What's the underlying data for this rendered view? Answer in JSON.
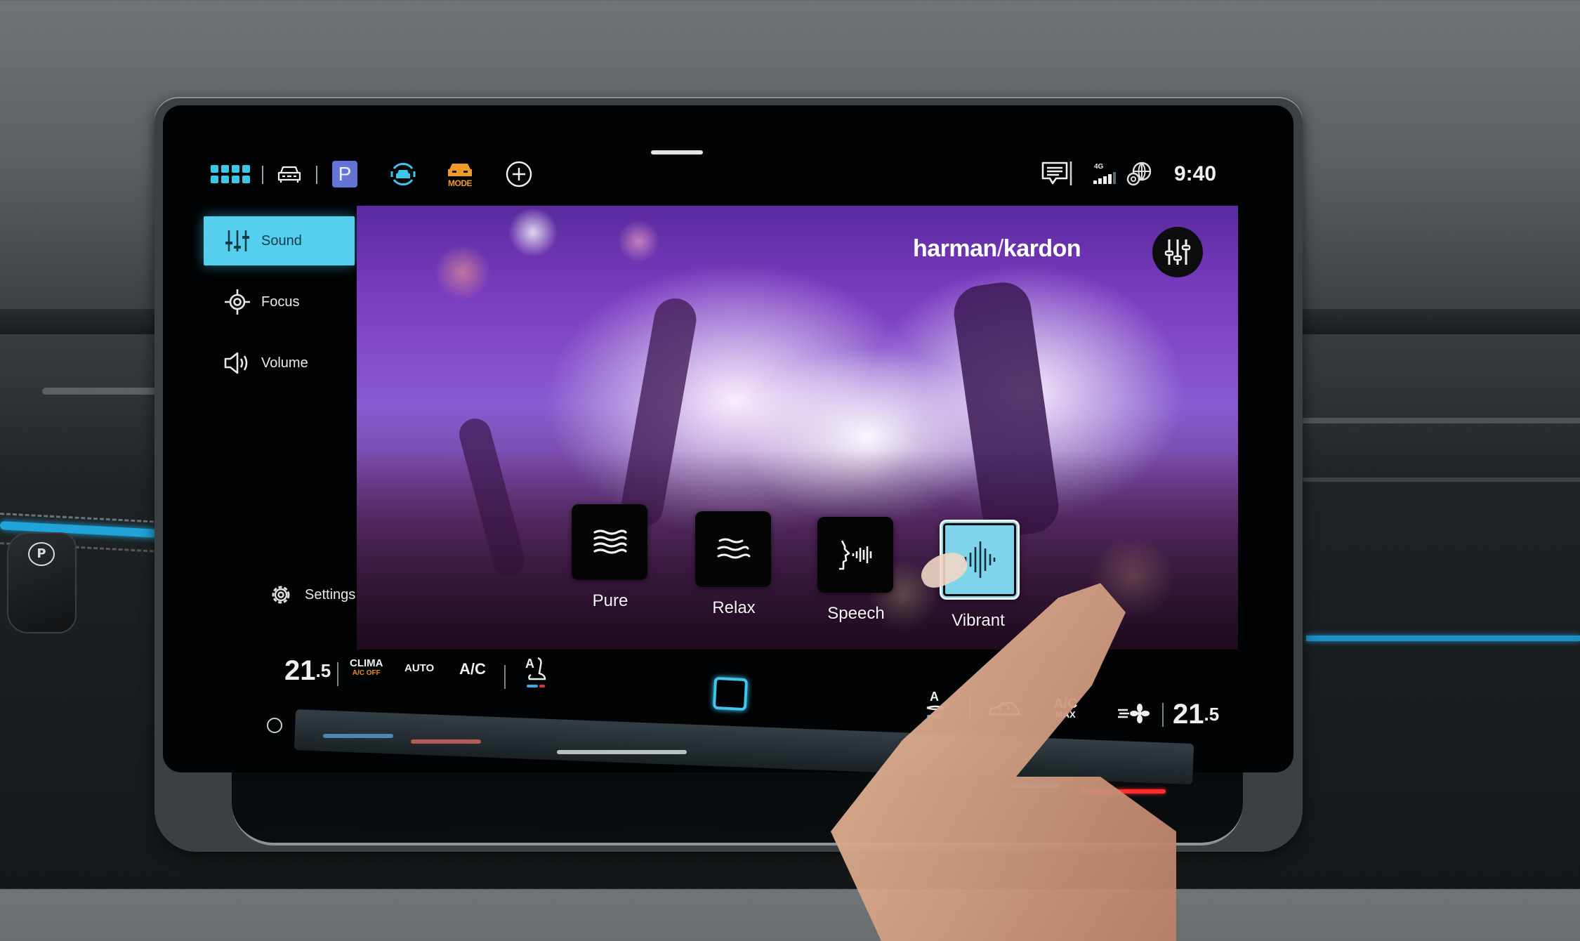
{
  "status_bar": {
    "icons": {
      "apps": "apps-grid-icon",
      "vehicle": "car-front-icon",
      "parking": "parking-icon",
      "assist": "driver-assist-icon",
      "drive_mode": "drive-mode-icon",
      "add": "add-circle-icon",
      "messages": "message-icon",
      "signal": "cellular-signal-icon",
      "online": "globe-icon"
    },
    "parking_label": "P",
    "drive_mode_label": "MODE",
    "network_label": "4G",
    "time": "9:40"
  },
  "sidebar": {
    "items": [
      {
        "label": "Sound",
        "icon": "equalizer-icon",
        "active": true
      },
      {
        "label": "Focus",
        "icon": "focus-target-icon",
        "active": false
      },
      {
        "label": "Volume",
        "icon": "speaker-icon",
        "active": false
      }
    ],
    "settings_label": "Settings"
  },
  "content": {
    "brand": {
      "left": "harman",
      "separator": "/",
      "right": "kardon"
    },
    "equalizer_button_icon": "equalizer-icon",
    "sound_modes": [
      {
        "label": "Pure",
        "icon": "waves-icon",
        "selected": false
      },
      {
        "label": "Relax",
        "icon": "waves-icon",
        "selected": false
      },
      {
        "label": "Speech",
        "icon": "speech-icon",
        "selected": false
      },
      {
        "label": "Vibrant",
        "icon": "soundwave-icon",
        "selected": true
      }
    ],
    "accent_color": "#56cfee"
  },
  "climate": {
    "left_temp": {
      "whole": "21",
      "decimal": ".5"
    },
    "clima_label": "CLIMA",
    "clima_sub": "A/C OFF",
    "auto_label": "AUTO",
    "ac_label": "A/C",
    "seat_left_label": "A",
    "seat_right_label": "A",
    "ac_max_label": "A/C",
    "ac_max_sub": "MAX",
    "right_temp": {
      "whole": "21",
      "decimal": ".5"
    }
  },
  "hardware": {
    "parking_brake_label": "P"
  }
}
